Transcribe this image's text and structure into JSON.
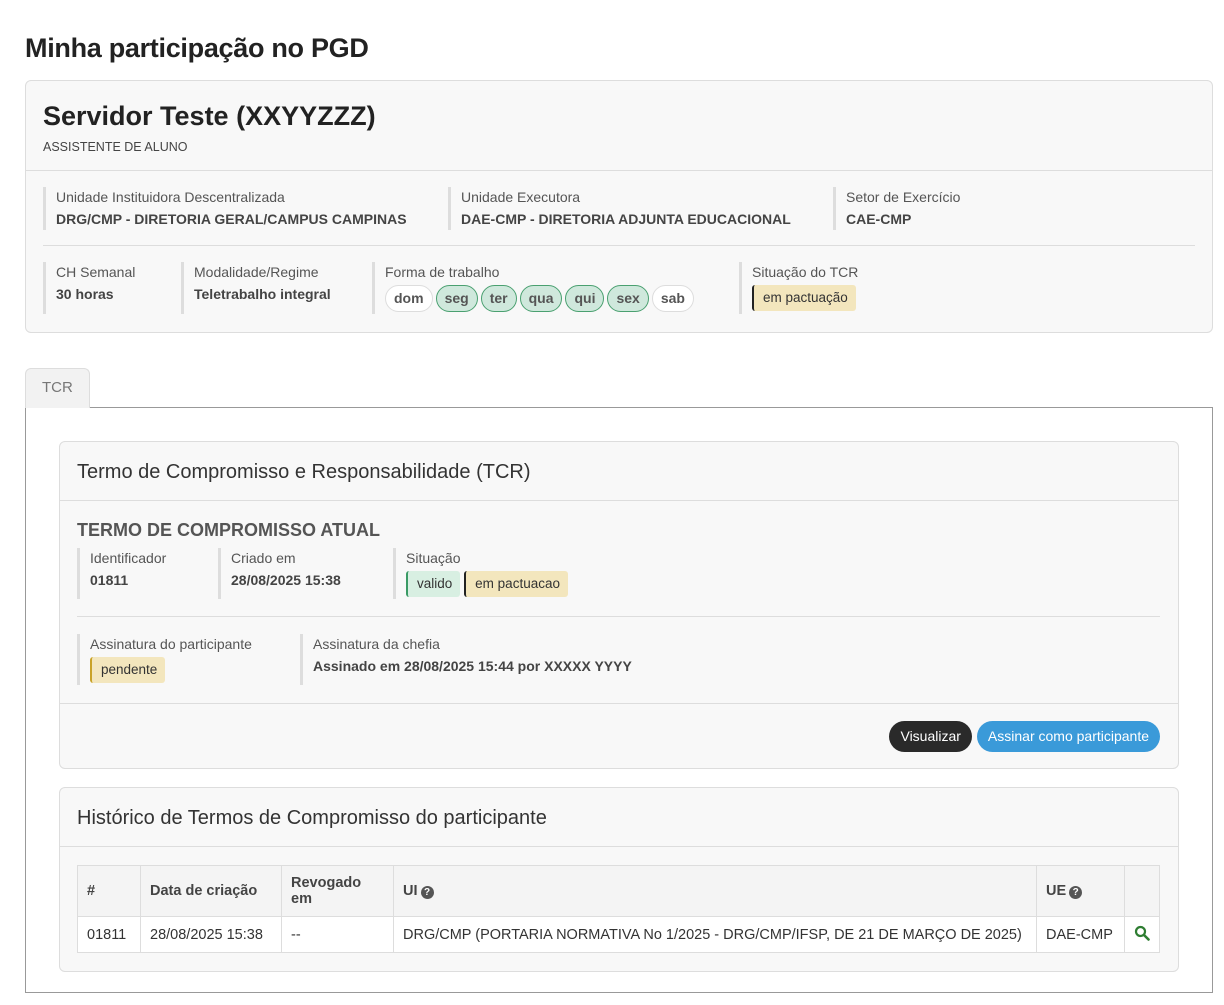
{
  "page": {
    "title": "Minha participação no PGD"
  },
  "profile": {
    "name": "Servidor Teste (XXYYZZZ)",
    "role": "ASSISTENTE DE ALUNO",
    "unidade_instituidora": {
      "label": "Unidade Instituidora Descentralizada",
      "value": "DRG/CMP - DIRETORIA GERAL/CAMPUS CAMPINAS"
    },
    "unidade_executora": {
      "label": "Unidade Executora",
      "value": "DAE-CMP - DIRETORIA ADJUNTA EDUCACIONAL"
    },
    "setor": {
      "label": "Setor de Exercício",
      "value": "CAE-CMP"
    },
    "ch_semanal": {
      "label": "CH Semanal",
      "value": "30 horas"
    },
    "modalidade": {
      "label": "Modalidade/Regime",
      "value": "Teletrabalho integral"
    },
    "forma_trabalho": {
      "label": "Forma de trabalho",
      "days": [
        {
          "label": "dom",
          "active": false
        },
        {
          "label": "seg",
          "active": true
        },
        {
          "label": "ter",
          "active": true
        },
        {
          "label": "qua",
          "active": true
        },
        {
          "label": "qui",
          "active": true
        },
        {
          "label": "sex",
          "active": true
        },
        {
          "label": "sab",
          "active": false
        }
      ]
    },
    "situacao_tcr": {
      "label": "Situação do TCR",
      "value": "em pactuação"
    }
  },
  "tabs": [
    {
      "label": "TCR"
    }
  ],
  "tcr": {
    "title": "Termo de Compromisso e Responsabilidade (TCR)",
    "current_title": "TERMO DE COMPROMISSO ATUAL",
    "identificador": {
      "label": "Identificador",
      "value": "01811"
    },
    "criado_em": {
      "label": "Criado em",
      "value": "28/08/2025 15:38"
    },
    "situacao": {
      "label": "Situação",
      "badges": [
        "valido",
        "em pactuacao"
      ]
    },
    "assinatura_participante": {
      "label": "Assinatura do participante",
      "value": "pendente"
    },
    "assinatura_chefia": {
      "label": "Assinatura da chefia",
      "value": "Assinado em 28/08/2025 15:44 por XXXXX YYYY"
    },
    "buttons": {
      "visualizar": "Visualizar",
      "assinar": "Assinar como participante"
    }
  },
  "historico": {
    "title": "Histórico de Termos de Compromisso do participante",
    "columns": [
      "#",
      "Data de criação",
      "Revogado em",
      "UI",
      "UE",
      ""
    ],
    "rows": [
      {
        "id": "01811",
        "data_criacao": "28/08/2025 15:38",
        "revogado_em": "--",
        "ui": "DRG/CMP (PORTARIA NORMATIVA No 1/2025 - DRG/CMP/IFSP, DE 21 DE MARÇO DE 2025)",
        "ue": "DAE-CMP"
      }
    ]
  },
  "colors": {
    "accent_blue": "#3a9ad9",
    "dark_button": "#2a2a2a",
    "day_active": "#cfe8dc",
    "badge_yellow": "#f3e6bd",
    "badge_green": "#d8efe2",
    "icon_green": "#2e7d32"
  },
  "icons": {
    "help": "question-circle-icon",
    "search": "search-icon"
  }
}
